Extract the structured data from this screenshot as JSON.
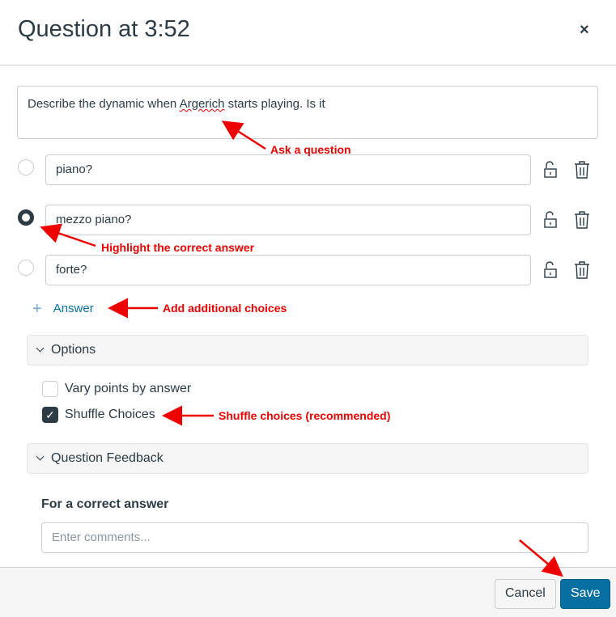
{
  "header": {
    "title": "Question at 3:52",
    "close_label": "×"
  },
  "question": {
    "prefix": "Describe the dynamic when ",
    "misspelled": "Argerich",
    "suffix": " starts playing. Is it"
  },
  "answers": [
    {
      "text": "piano?",
      "correct": false
    },
    {
      "text": "mezzo piano?",
      "correct": true
    },
    {
      "text": "forte?",
      "correct": false
    }
  ],
  "add_answer": {
    "plus": "+",
    "label": "Answer"
  },
  "options": {
    "header": "Options",
    "vary_points": {
      "label": "Vary points by answer",
      "checked": false
    },
    "shuffle": {
      "label": "Shuffle Choices",
      "checked": true,
      "check": "✓"
    }
  },
  "feedback": {
    "header": "Question Feedback",
    "correct_label": "For a correct answer",
    "placeholder": "Enter comments..."
  },
  "footer": {
    "cancel": "Cancel",
    "save": "Save"
  },
  "annotations": {
    "ask": "Ask a question",
    "highlight": "Highlight the correct answer",
    "add": "Add additional choices",
    "shuffle": "Shuffle choices (recommended)"
  },
  "colors": {
    "accent": "#0770a3",
    "annotation": "#e00000",
    "text": "#2d3b45"
  }
}
